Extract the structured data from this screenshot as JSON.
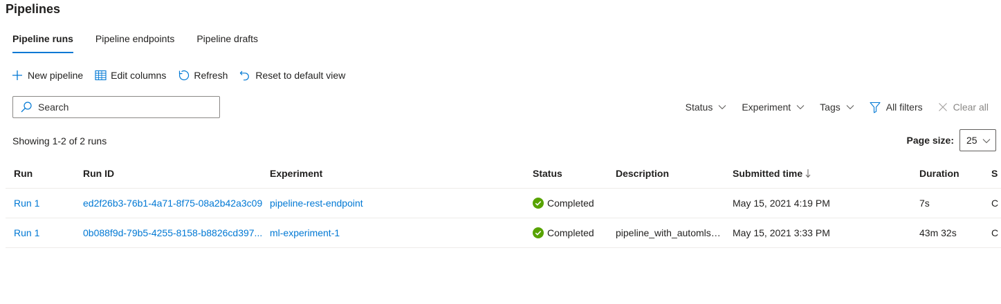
{
  "page": {
    "title": "Pipelines"
  },
  "tabs": [
    {
      "label": "Pipeline runs",
      "active": true
    },
    {
      "label": "Pipeline endpoints",
      "active": false
    },
    {
      "label": "Pipeline drafts",
      "active": false
    }
  ],
  "toolbar": {
    "new_pipeline": {
      "label": "New pipeline",
      "icon": "plus-icon"
    },
    "edit_columns": {
      "label": "Edit columns",
      "icon": "table-grid-icon"
    },
    "refresh": {
      "label": "Refresh",
      "icon": "refresh-icon"
    },
    "reset_view": {
      "label": "Reset to default view",
      "icon": "undo-arrow-icon"
    }
  },
  "search": {
    "placeholder": "Search",
    "value": "",
    "icon": "search-icon"
  },
  "filters": {
    "status": "Status",
    "experiment": "Experiment",
    "tags": "Tags",
    "all_filters": "All filters",
    "clear_all": "Clear all"
  },
  "summary": {
    "showing": "Showing 1-2 of 2 runs"
  },
  "page_size": {
    "label": "Page size:",
    "value": "25"
  },
  "table": {
    "columns": [
      "Run",
      "Run ID",
      "Experiment",
      "Status",
      "Description",
      "Submitted time",
      "Duration",
      "S"
    ],
    "sort_column": "Submitted time",
    "sort_direction": "descending",
    "rows": [
      {
        "run": "Run 1",
        "run_id": "ed2f26b3-76b1-4a71-8f75-08a2b42a3c09",
        "experiment": "pipeline-rest-endpoint",
        "status": "Completed",
        "description": "",
        "submitted": "May 15, 2021 4:19 PM",
        "duration": "7s",
        "extra": "C"
      },
      {
        "run": "Run 1",
        "run_id": "0b088f9d-79b5-4255-8158-b8826cd397...",
        "experiment": "ml-experiment-1",
        "status": "Completed",
        "description": "pipeline_with_automlst...",
        "submitted": "May 15, 2021 3:33 PM",
        "duration": "43m 32s",
        "extra": "C"
      }
    ]
  },
  "colors": {
    "accent": "#0078d4",
    "status_completed": "#57a300",
    "border": "#edebe9"
  }
}
